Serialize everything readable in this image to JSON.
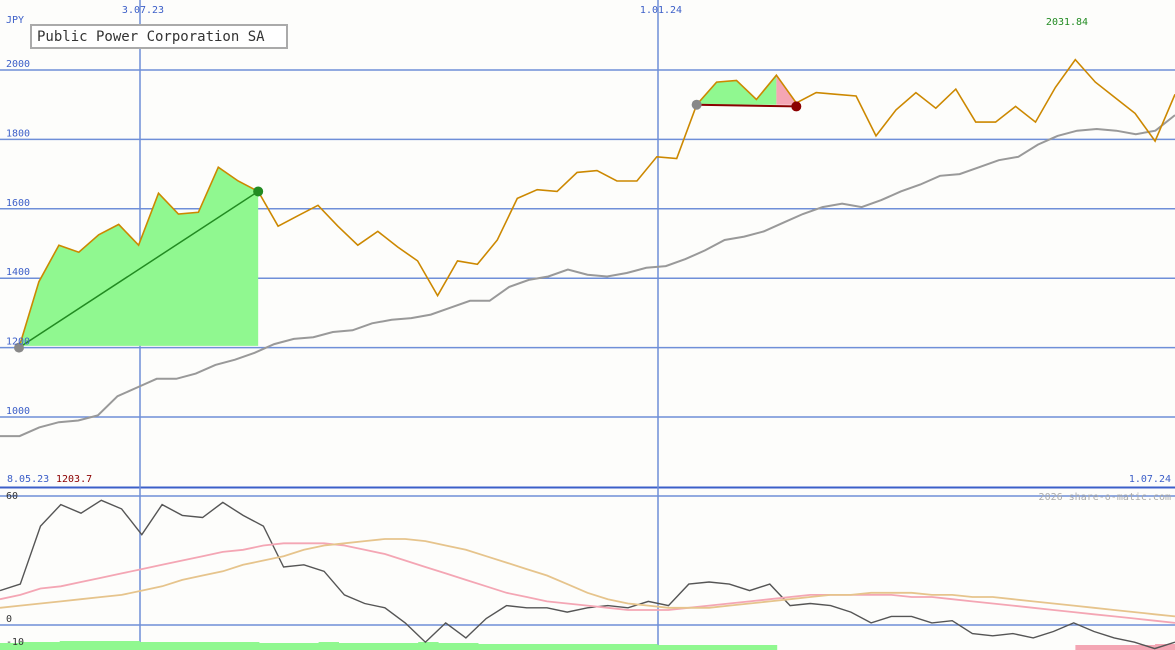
{
  "chart_data": [
    {
      "type": "line",
      "title": "Public Power Corporation SA",
      "currency_label": "JPY",
      "x_dates": [
        "3.07.23",
        "1.01.24"
      ],
      "range_start_label": "8.05.23",
      "range_start_value": "1203.7",
      "range_end_label": "1.07.24",
      "max_value_label": "2031.84",
      "yticks": [
        1000,
        1200,
        1400,
        1600,
        1800,
        2000
      ],
      "ytick_labels": [
        "1000",
        "1200",
        "1400",
        "1600",
        "1800",
        "2000"
      ],
      "ylim": [
        950,
        2110
      ],
      "grid": true,
      "series": [
        {
          "values": [
            1200,
            1390,
            1495,
            1475,
            1525,
            1555,
            1495,
            1645,
            1585,
            1590,
            1720,
            1680,
            1650,
            1550,
            1580,
            1610,
            1550,
            1495,
            1535,
            1490,
            1450,
            1350,
            1450,
            1440,
            1510,
            1630,
            1655,
            1650,
            1705,
            1710,
            1680,
            1680,
            1750,
            1745,
            1900,
            1965,
            1970,
            1915,
            1985,
            1905,
            1935,
            1930,
            1925,
            1810,
            1885,
            1935,
            1890,
            1945,
            1850,
            1850,
            1895,
            1850,
            1950,
            2030,
            1965,
            1920,
            1875,
            1795,
            1930
          ]
        },
        {
          "values": [
            945,
            945,
            970,
            985,
            990,
            1005,
            1060,
            1085,
            1110,
            1110,
            1125,
            1150,
            1165,
            1185,
            1210,
            1225,
            1230,
            1245,
            1250,
            1270,
            1280,
            1285,
            1295,
            1315,
            1335,
            1335,
            1375,
            1395,
            1405,
            1425,
            1410,
            1405,
            1415,
            1430,
            1435,
            1455,
            1480,
            1510,
            1520,
            1535,
            1560,
            1585,
            1605,
            1615,
            1605,
            1625,
            1650,
            1670,
            1695,
            1700,
            1720,
            1740,
            1750,
            1785,
            1810,
            1825,
            1830,
            1825,
            1815,
            1825,
            1870
          ]
        }
      ],
      "trades": [
        {
          "entry": 1200,
          "exit": 1645
        },
        {
          "entry": 1900,
          "exit": 1895
        }
      ],
      "colors": {
        "price": "#cc8800",
        "comparison": "#999999",
        "grid": "#6f8fd8",
        "profit_fill": "#90f890",
        "loss_fill": "#f4a6b4",
        "trade_win": "#228b22",
        "trade_loss": "#8b0000",
        "label_blue": "#3c5fc8",
        "label_red": "#8b0000",
        "label_green": "#228b22"
      }
    },
    {
      "type": "line",
      "yticks": [
        -10,
        0,
        60
      ],
      "ytick_labels": [
        "-10",
        "0",
        "60"
      ],
      "ylim": [
        -10,
        62
      ],
      "watermark": "2026 share-o-matic.com",
      "series": [
        {
          "color": "#555555",
          "values": [
            16,
            19,
            46,
            56,
            52,
            58,
            54,
            42,
            56,
            51,
            50,
            57,
            51,
            46,
            27,
            28,
            25,
            14,
            10,
            8,
            1,
            -8,
            1,
            -6,
            3,
            9,
            8,
            8,
            6,
            8,
            9,
            8,
            11,
            9,
            19,
            20,
            19,
            16,
            19,
            9,
            10,
            9,
            6,
            1,
            4,
            4,
            1,
            2,
            -4,
            -5,
            -4,
            -6,
            -3,
            1,
            -3,
            -6,
            -8,
            -11,
            -8
          ]
        },
        {
          "color": "#f4a6b4",
          "values": [
            12,
            14,
            17,
            18,
            20,
            22,
            24,
            26,
            28,
            30,
            32,
            34,
            35,
            37,
            38,
            38,
            38,
            37,
            35,
            33,
            30,
            27,
            24,
            21,
            18,
            15,
            13,
            11,
            10,
            9,
            8,
            7,
            7,
            7,
            8,
            9,
            10,
            11,
            12,
            13,
            14,
            14,
            14,
            14,
            14,
            13,
            13,
            12,
            11,
            10,
            9,
            8,
            7,
            6,
            5,
            4,
            3,
            2,
            1
          ]
        },
        {
          "color": "#e6c48c",
          "values": [
            8,
            9,
            10,
            11,
            12,
            13,
            14,
            16,
            18,
            21,
            23,
            25,
            28,
            30,
            32,
            35,
            37,
            38,
            39,
            40,
            40,
            39,
            37,
            35,
            32,
            29,
            26,
            23,
            19,
            15,
            12,
            10,
            9,
            8,
            8,
            8,
            9,
            10,
            11,
            12,
            13,
            14,
            14,
            15,
            15,
            15,
            14,
            14,
            13,
            13,
            12,
            11,
            10,
            9,
            8,
            7,
            6,
            5,
            4
          ]
        }
      ],
      "volume": {
        "values": [
          7,
          8,
          8,
          9,
          9,
          9,
          9,
          8,
          8,
          8,
          8,
          8,
          8,
          7,
          7,
          7,
          8,
          7,
          7,
          7,
          7,
          8,
          7,
          7,
          6,
          6,
          6,
          6,
          6,
          6,
          6,
          6,
          6,
          5,
          5,
          5,
          5,
          5,
          5,
          5,
          5,
          5,
          5,
          5,
          5,
          5,
          5,
          5,
          5,
          5,
          5,
          5,
          5,
          5,
          5,
          5,
          5,
          5,
          6
        ],
        "colors": [
          "g",
          "g",
          "g",
          "g",
          "g",
          "g",
          "g",
          "g",
          "g",
          "g",
          "g",
          "g",
          "g",
          "g",
          "g",
          "g",
          "g",
          "g",
          "g",
          "g",
          "g",
          "g",
          "g",
          "g",
          "g",
          "g",
          "g",
          "g",
          "g",
          "g",
          "g",
          "g",
          "g",
          "g",
          "g",
          "g",
          "g",
          "g",
          "g",
          "w",
          "w",
          "w",
          "w",
          "w",
          "w",
          "w",
          "w",
          "w",
          "w",
          "w",
          "w",
          "w",
          "w",
          "w",
          "p",
          "p",
          "p",
          "p",
          "p"
        ]
      }
    }
  ]
}
